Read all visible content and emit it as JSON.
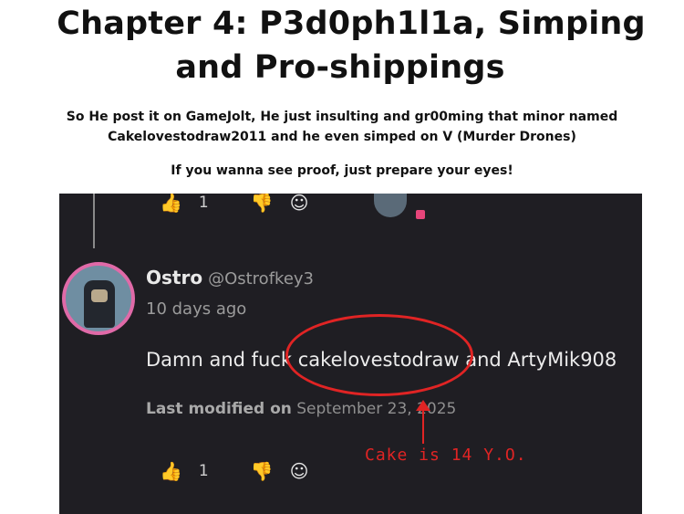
{
  "title_line1": "Chapter 4: P3d0ph1l1a, Simping",
  "title_line2": "and Pro-shippings",
  "paragraph1_line1": "So He post it on GameJolt, He just insulting and gr00ming that minor named",
  "paragraph1_line2": "Cakelovestodraw2011 and he even simped on V (Murder Drones)",
  "paragraph2": "If you wanna see proof, just prepare your eyes!",
  "screenshot": {
    "top_like_count": "1",
    "username": "Ostro",
    "handle": "@Ostrofkey3",
    "timestamp": "10 days ago",
    "comment": "Damn and fuck cakelovestodraw and ArtyMik908",
    "modified_label": "Last modified on",
    "modified_date": "September 23, 2025",
    "bottom_like_count": "1",
    "annotation": "Cake is 14 Y.O.",
    "icons": [
      "thumbs-up-icon",
      "thumbs-down-icon",
      "add-reaction-icon"
    ],
    "annotation_color": "#e02424",
    "avatar_ring_color": "#e06aa8"
  }
}
